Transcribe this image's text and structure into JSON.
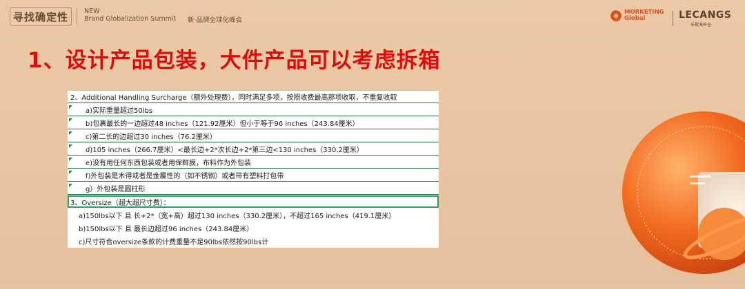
{
  "header": {
    "brand_mark": "寻找确定性",
    "event_line1": "NEW",
    "event_line2": "Brand Globalization Summit",
    "event_cn": "新·品牌全球化峰会",
    "partner1_line1": "MORKETING",
    "partner1_line2": "Global",
    "partner2_name": "LECANGS",
    "partner2_sub": "乐歌海外仓"
  },
  "title": "1、设计产品包装，大件产品可以考虑拆箱",
  "table": {
    "rows": [
      "2、Additional Handling Surcharge（额外处理费），同时满足多项，按照收费最高那项收取，不重复收取",
      "a)实际重量超过50lbs",
      "b)包裹最长的一边超过48 inches（121.92厘米）但小于等于96 inches（243.84厘米）",
      "c)第二长的边超过30 inches（76.2厘米）",
      "d)105 inches（266.7厘米）<最长边+2*次长边+2*第三边<130 inches（330.2厘米）",
      "e)没有用任何东西包装或者用保鲜膜，布料作为外包装",
      "f)外包装是木得或者是金屬性的（如不锈钢）或者带有塑料打包带",
      "g）外包装是圆柱形",
      "3、Oversize（超大超尺寸费）：",
      "a)150lbs以下 且 长+2*（宽+高）超过130 inches（330.2厘米），不超过165 inches（419.1厘米）",
      "b)150lbs以下 且 最长边超过96 inches（243.84厘米）",
      "c)尺寸符合oversize条款的计费重量不足90lbs依然按90lbs计"
    ]
  },
  "colors": {
    "title": "#e00a0a",
    "background": "#e8c39f",
    "accent": "#e0531d",
    "highlight": "#2fa25a"
  }
}
